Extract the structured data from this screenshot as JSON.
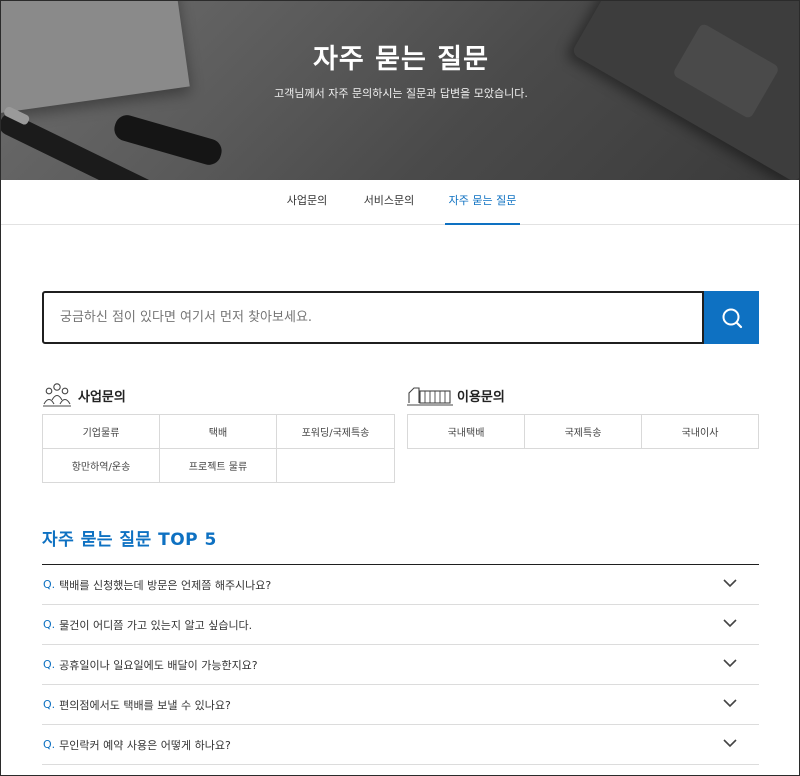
{
  "hero": {
    "title": "자주 묻는 질문",
    "subtitle": "고객님께서 자주 문의하시는 질문과 답변을 모았습니다."
  },
  "tabs": [
    {
      "label": "사업문의",
      "active": false
    },
    {
      "label": "서비스문의",
      "active": false
    },
    {
      "label": "자주 묻는 질문",
      "active": true
    }
  ],
  "search": {
    "placeholder": "궁금하신 점이 있다면 여기서 먼저 찾아보세요.",
    "button_icon": "search-icon"
  },
  "categories": {
    "business": {
      "title": "사업문의",
      "icon": "people-group-icon",
      "items": [
        "기업물류",
        "택배",
        "포워딩/국제특송",
        "항만하역/운송",
        "프로젝트 물류"
      ]
    },
    "usage": {
      "title": "이용문의",
      "icon": "delivery-truck-icon",
      "items": [
        "국내택배",
        "국제특송",
        "국내이사"
      ]
    }
  },
  "faq": {
    "title": "자주 묻는 질문 TOP 5",
    "q_prefix": "Q.",
    "items": [
      "택배를 신청했는데 방문은 언제쯤 해주시나요?",
      "물건이 어디쯤 가고 있는지 알고 싶습니다.",
      "공휴일이나 일요일에도 배달이 가능한지요?",
      "편의점에서도 택배를 보낼 수 있나요?",
      "무인락커 예약 사용은 어떻게 하나요?"
    ]
  },
  "colors": {
    "accent": "#0e71c2",
    "border": "#d9d9d9",
    "text": "#333333"
  }
}
